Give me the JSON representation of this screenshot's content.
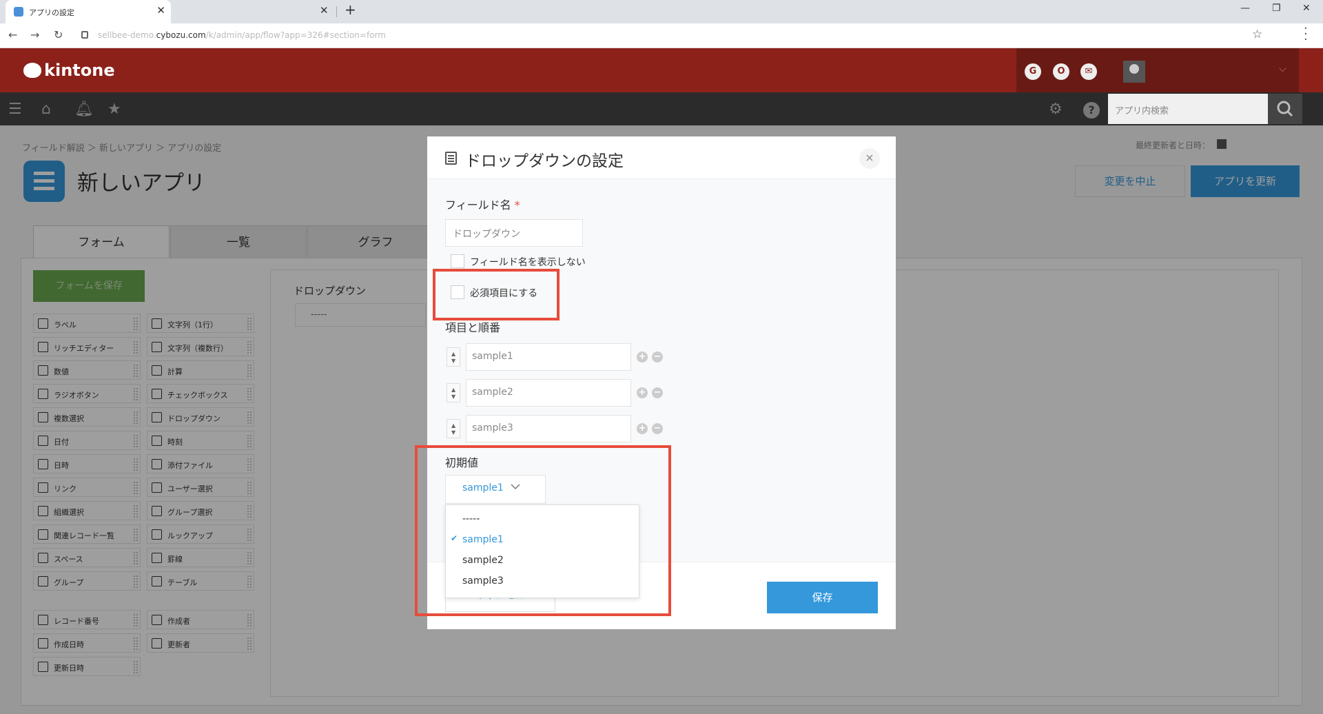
{
  "browser": {
    "tab_title": "アプリの設定",
    "url_prefix": "sellbee-demo.",
    "url_domain": "cybozu.com",
    "url_path": "/k/admin/app/flow?app=326#section=form",
    "new_tab": "+",
    "close": "✕"
  },
  "header": {
    "logo": "kintone",
    "icons": [
      "G",
      "O",
      "✉"
    ],
    "search_placeholder": "アプリ内検索"
  },
  "page": {
    "breadcrumb": "フィールド解説 ＞ 新しいアプリ ＞ アプリの設定",
    "app_title": "新しいアプリ",
    "last_updated": "最終更新者と日時：",
    "cancel_changes": "変更を中止",
    "update_app": "アプリを更新",
    "tabs": [
      "フォーム",
      "一覧",
      "グラフ"
    ],
    "save_form": "フォームを保存"
  },
  "palette": {
    "left": [
      "ラベル",
      "リッチエディター",
      "数値",
      "ラジオボタン",
      "複数選択",
      "日付",
      "日時",
      "リンク",
      "組織選択",
      "関連レコード一覧",
      "スペース",
      "グループ"
    ],
    "right": [
      "文字列（1行）",
      "文字列（複数行）",
      "計算",
      "チェックボックス",
      "ドロップダウン",
      "時刻",
      "添付ファイル",
      "ユーザー選択",
      "グループ選択",
      "ルックアップ",
      "罫線",
      "テーブル"
    ],
    "sys_left": [
      "レコード番号",
      "作成日時",
      "更新日時"
    ],
    "sys_right": [
      "作成者",
      "更新者"
    ]
  },
  "canvas": {
    "field_label": "ドロップダウン",
    "field_value": "-----"
  },
  "dialog": {
    "title": "ドロップダウンの設定",
    "close": "×",
    "field_name_label": "フィールド名",
    "required_mark": "*",
    "field_name_value": "ドロップダウン",
    "hide_name_label": "フィールド名を表示しない",
    "required_label": "必須項目にする",
    "options_label": "項目と順番",
    "options": [
      "sample1",
      "sample2",
      "sample3"
    ],
    "default_label": "初期値",
    "default_value": "sample1",
    "dropdown_items": [
      "-----",
      "sample1",
      "sample2",
      "sample3"
    ],
    "checkmark": "✔",
    "cancel": "キャンセル",
    "save": "保存"
  },
  "colors": {
    "header": "#8c211a",
    "nav": "#2b2b2b",
    "accent": "#3498db",
    "highlight": "#e74c3c"
  }
}
